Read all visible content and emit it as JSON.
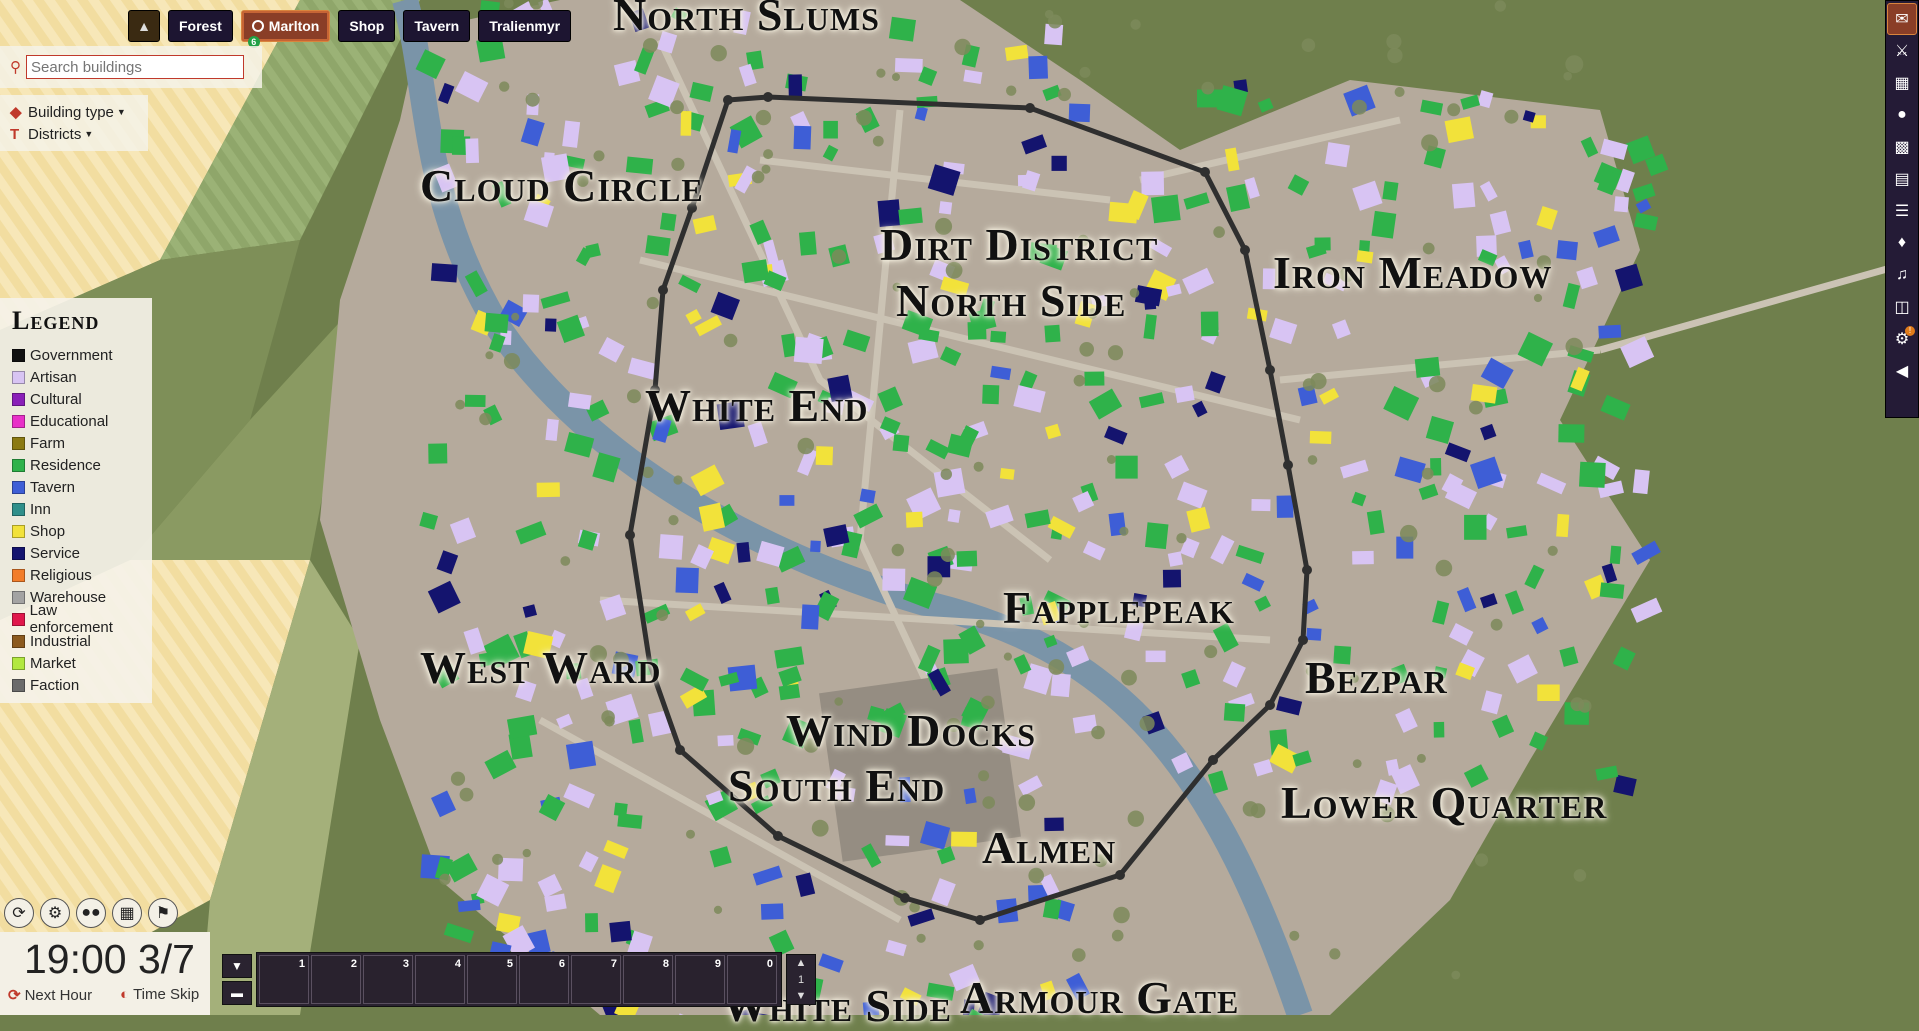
{
  "top_tabs": [
    {
      "label": "Forest"
    },
    {
      "label": "Marlton",
      "badge": "6"
    },
    {
      "label": "Shop"
    },
    {
      "label": "Tavern"
    },
    {
      "label": "Tralienmyr"
    }
  ],
  "search": {
    "placeholder": "Search buildings"
  },
  "filters": {
    "building_type": "Building type",
    "districts": "Districts"
  },
  "legend": {
    "title": "Legend",
    "items": [
      {
        "label": "Government",
        "color": "#111111"
      },
      {
        "label": "Artisan",
        "color": "#d8c4f3"
      },
      {
        "label": "Cultural",
        "color": "#8a1fb8"
      },
      {
        "label": "Educational",
        "color": "#e830c8"
      },
      {
        "label": "Farm",
        "color": "#8b7a12"
      },
      {
        "label": "Residence",
        "color": "#2fb24a"
      },
      {
        "label": "Tavern",
        "color": "#3e5ed6"
      },
      {
        "label": "Inn",
        "color": "#2f8f8a"
      },
      {
        "label": "Shop",
        "color": "#f2e23a"
      },
      {
        "label": "Service",
        "color": "#14146e"
      },
      {
        "label": "Religious",
        "color": "#f27d2a"
      },
      {
        "label": "Warehouse",
        "color": "#a3a3a3"
      },
      {
        "label": "Law enforcement",
        "color": "#e0174b"
      },
      {
        "label": "Industrial",
        "color": "#8c5a1e"
      },
      {
        "label": "Market",
        "color": "#b2e840"
      },
      {
        "label": "Faction",
        "color": "#6b6b6b"
      }
    ]
  },
  "districts": [
    "North Slums",
    "Cloud Circle",
    "Dirt District",
    "North Side",
    "Iron Meadow",
    "White End",
    "Fapplepeak",
    "West Ward",
    "Bezpar",
    "Wind Docks",
    "South End",
    "Lower Quarter",
    "Almen",
    "White Side",
    "Armour Gate"
  ],
  "right_toolbar": {
    "icons": [
      "chat-icon",
      "combat-icon",
      "map-icon",
      "actor-icon",
      "items-icon",
      "journal-icon",
      "table-icon",
      "cards-icon",
      "music-icon",
      "compendium-icon",
      "settings-icon",
      "collapse-icon"
    ],
    "settings_badge": "!"
  },
  "clock": {
    "time": "19:00 3/7",
    "next_hour": "Next Hour",
    "time_skip": "Time Skip"
  },
  "hotbar": {
    "slots": [
      "1",
      "2",
      "3",
      "4",
      "5",
      "6",
      "7",
      "8",
      "9",
      "0"
    ],
    "page": "1"
  },
  "colors": {
    "river": "#7a94a8",
    "road": "#c9c1b2",
    "wall": "#2f2f2f",
    "field": "#f3dfa2",
    "grass": "#6f7f4c"
  }
}
